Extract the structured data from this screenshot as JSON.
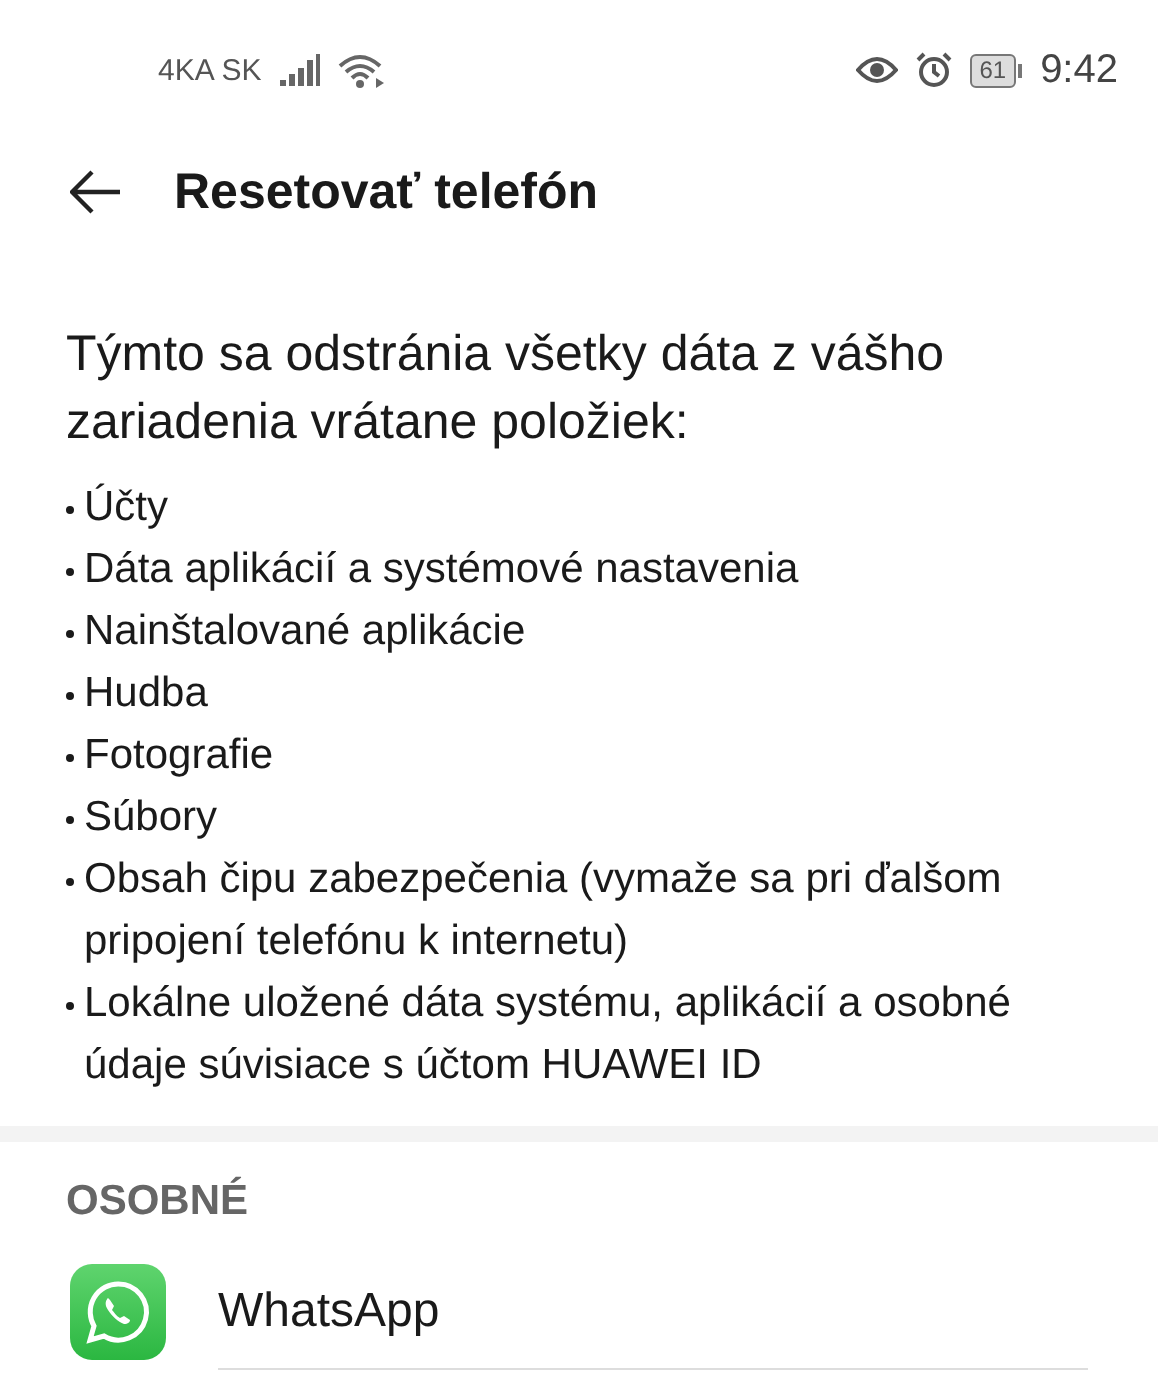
{
  "status_bar": {
    "carrier": "4KA SK",
    "battery": "61",
    "time": "9:42"
  },
  "header": {
    "title": "Resetovať telefón"
  },
  "intro": "Týmto sa odstránia všetky dáta z vášho zariadenia vrátane položiek:",
  "items": [
    "Účty",
    "Dáta aplikácií a systémové nastavenia",
    "Nainštalované aplikácie",
    "Hudba",
    "Fotografie",
    "Súbory",
    "Obsah čipu zabezpečenia (vymaže sa pri ďalšom pripojení telefónu k internetu)",
    "Lokálne uložené dáta systému, aplikácií a osobné údaje súvisiace s účtom HUAWEI ID"
  ],
  "section": {
    "title": "OSOBNÉ",
    "apps": [
      {
        "name": "WhatsApp"
      }
    ]
  }
}
